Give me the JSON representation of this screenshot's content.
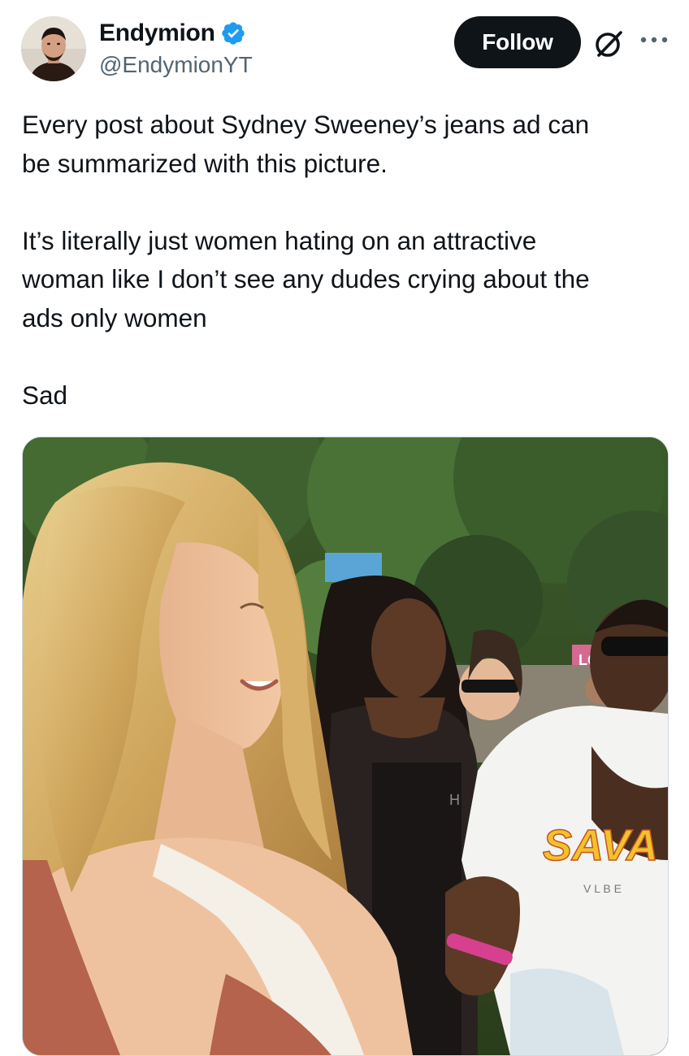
{
  "author": {
    "display_name": "Endymion",
    "handle": "@EndymionYT",
    "verified": true,
    "avatar_icon": "profile-photo"
  },
  "actions": {
    "follow_label": "Follow",
    "grok_icon": "grok-icon",
    "more_icon": "more-horizontal-icon"
  },
  "tweet": {
    "paragraphs": [
      "Every post about Sydney Sweeney’s jeans ad can\nbe summarized with this picture.",
      "It’s literally just women hating on an attractive\nwoman like I don’t see any dudes crying about the\nads only women",
      "Sad"
    ]
  },
  "media": {
    "type": "photo",
    "visible_text": [
      "LOL",
      "SAVA",
      "V L B E",
      "H"
    ]
  },
  "colors": {
    "text_primary": "#0f1419",
    "text_secondary": "#536471",
    "verified_blue": "#1d9bf0",
    "follow_bg": "#0f1419",
    "border": "#cfd9de"
  }
}
